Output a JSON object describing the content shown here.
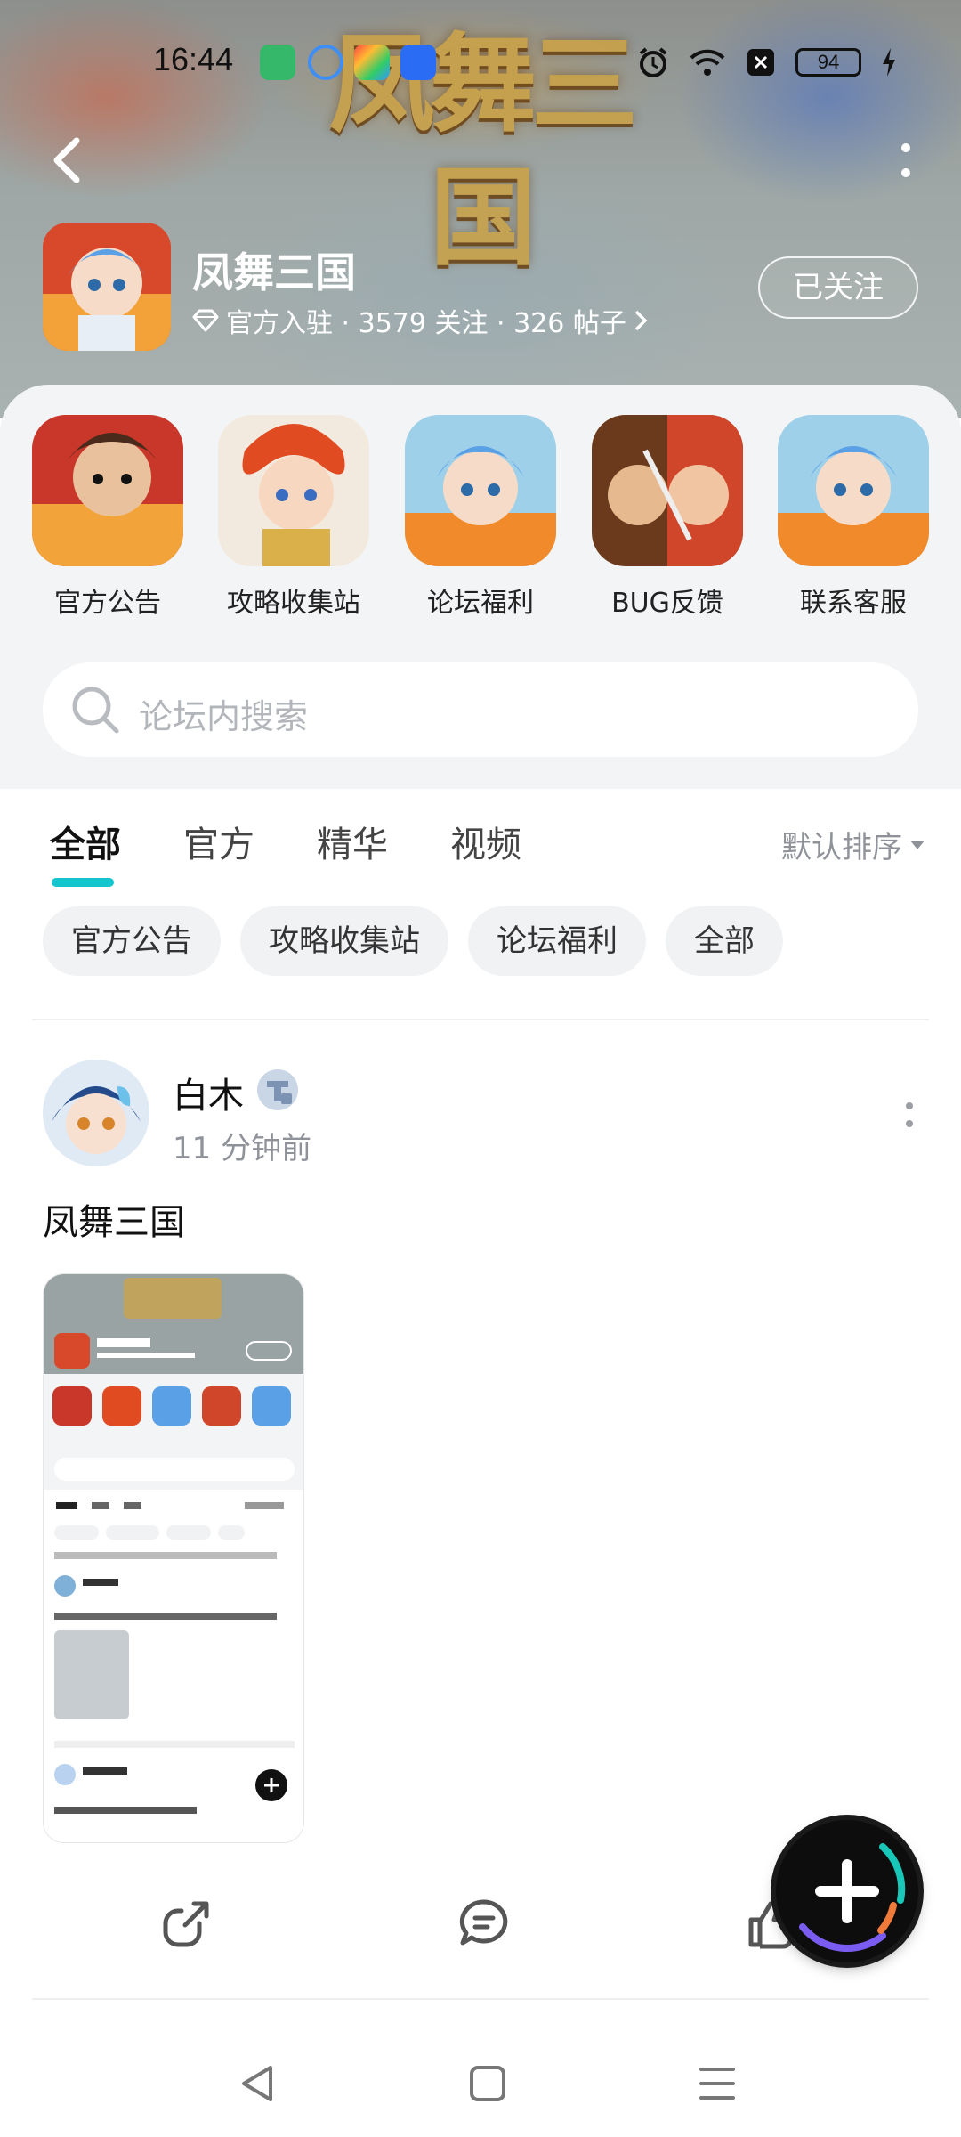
{
  "status_bar": {
    "time": "16:44",
    "battery": "94"
  },
  "forum": {
    "name": "凤舞三国",
    "banner_art_text": "凤舞三国",
    "meta": "官方入驻 · 3579 关注 · 326 帖子",
    "follow_label": "已关注"
  },
  "shortcuts": [
    {
      "label": "官方公告"
    },
    {
      "label": "攻略收集站"
    },
    {
      "label": "论坛福利"
    },
    {
      "label": "BUG反馈"
    },
    {
      "label": "联系客服"
    }
  ],
  "search": {
    "placeholder": "论坛内搜索"
  },
  "tabs": [
    {
      "label": "全部"
    },
    {
      "label": "官方"
    },
    {
      "label": "精华"
    },
    {
      "label": "视频"
    }
  ],
  "sort_label": "默认排序",
  "chips": [
    {
      "label": "官方公告"
    },
    {
      "label": "攻略收集站"
    },
    {
      "label": "论坛福利"
    },
    {
      "label": "全部"
    }
  ],
  "post": {
    "author": "白木",
    "time": "11 分钟前",
    "title": "凤舞三国"
  },
  "colors": {
    "accent": "#15c5ce",
    "panel_bg": "#f3f4f6"
  },
  "icons": [
    "back-arrow-icon",
    "more-vert-icon",
    "diamond-icon",
    "chevron-right-icon",
    "search-icon",
    "share-icon",
    "comment-icon",
    "like-icon",
    "plus-icon",
    "nav-back-icon",
    "nav-home-icon",
    "nav-menu-icon"
  ]
}
